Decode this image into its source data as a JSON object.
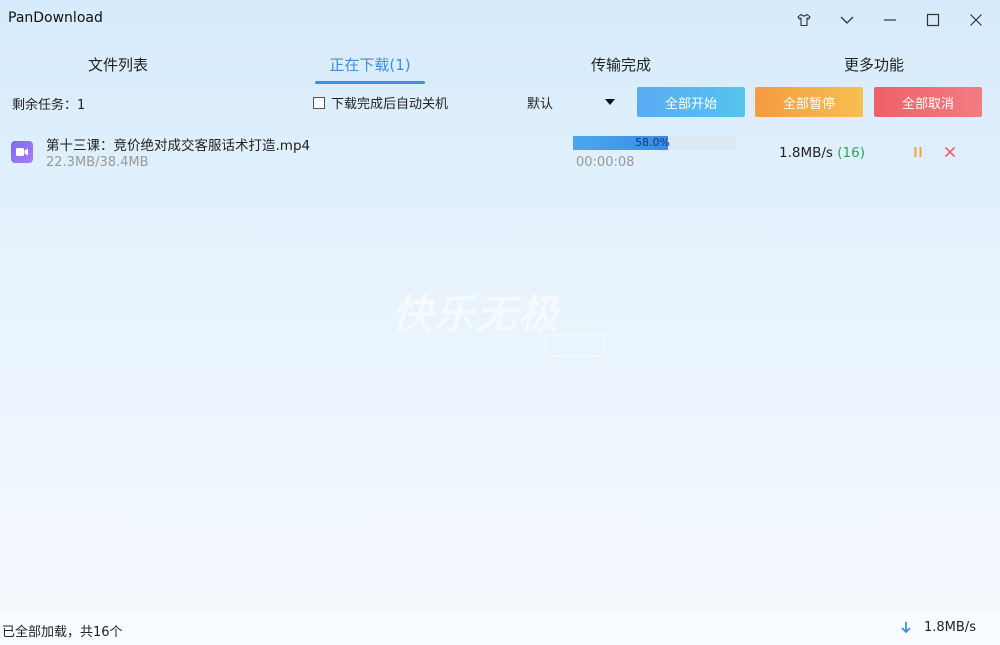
{
  "app": {
    "title": "PanDownload"
  },
  "window_controls": {
    "skin": "shirt-icon",
    "menu": "chevron-down-icon",
    "minimize": "minimize-icon",
    "maximize": "maximize-icon",
    "close": "close-icon"
  },
  "tabs": [
    {
      "label": "文件列表",
      "active": false
    },
    {
      "label": "正在下载(1)",
      "active": true
    },
    {
      "label": "传输完成",
      "active": false
    },
    {
      "label": "更多功能",
      "active": false
    }
  ],
  "toolbar": {
    "remaining_tasks": "剩余任务：1",
    "shutdown_label": "下载完成后自动关机",
    "shutdown_checked": false,
    "sort_value": "默认",
    "start_all": "全部开始",
    "pause_all": "全部暂停",
    "cancel_all": "全部取消"
  },
  "tasks": [
    {
      "file_icon": "video-icon",
      "name": "第十三课：竞价绝对成交客服话术打造.mp4",
      "size": "22.3MB/38.4MB",
      "progress_text": "58.0%",
      "progress": 0.58,
      "elapsed": "00:00:08",
      "speed": "1.8MB/s",
      "connections": "(16)"
    }
  ],
  "watermark": "快乐无极",
  "status": {
    "text": "已全部加载，共16个",
    "speed": "1.8MB/s"
  },
  "colors": {
    "accent": "#3b8fe0",
    "start": "#5aaaf2",
    "pause": "#f59a3f",
    "cancel": "#f06068",
    "connections": "#26a65b"
  }
}
